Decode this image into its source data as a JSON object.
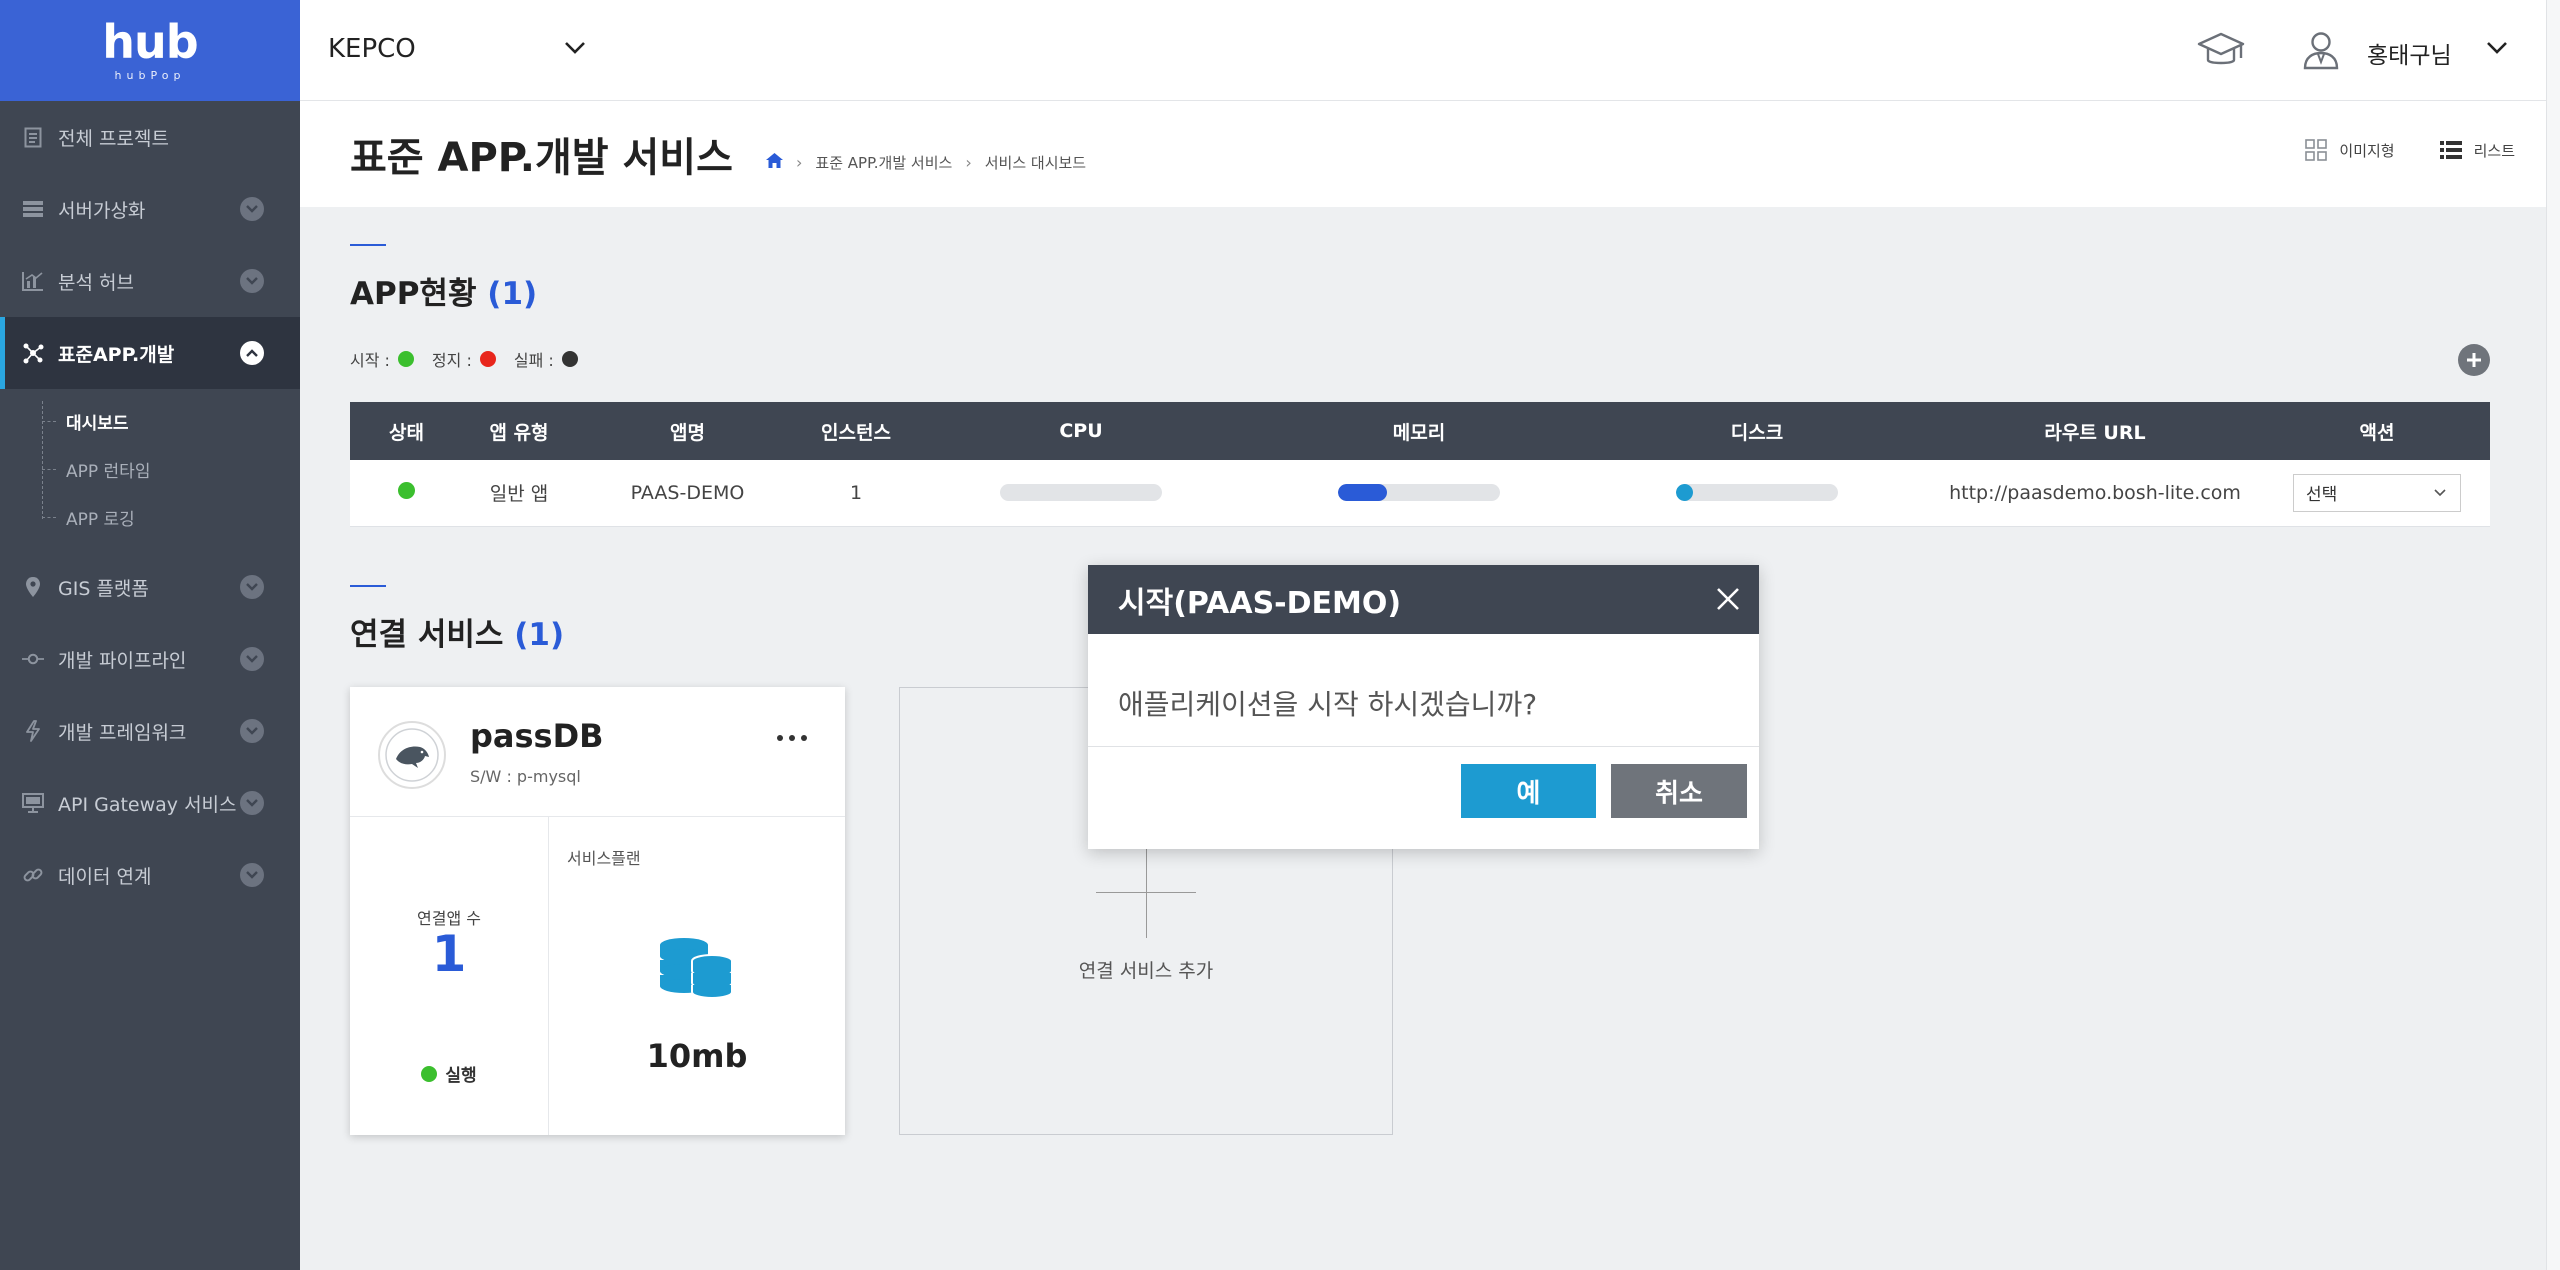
{
  "logo": {
    "mark": "hub",
    "sub": "hubPop"
  },
  "sidebar": {
    "items": [
      {
        "label": "전체 프로젝트",
        "icon": "clipboard-icon"
      },
      {
        "label": "서버가상화",
        "icon": "server-icon"
      },
      {
        "label": "분석 허브",
        "icon": "chart-icon"
      },
      {
        "label": "표준APP.개발",
        "icon": "network-icon"
      },
      {
        "label": "GIS 플랫폼",
        "icon": "map-pin-icon"
      },
      {
        "label": "개발 파이프라인",
        "icon": "pipeline-icon"
      },
      {
        "label": "개발 프레임워크",
        "icon": "bolt-icon"
      },
      {
        "label": "API Gateway 서비스",
        "icon": "monitor-icon"
      },
      {
        "label": "데이터 연계",
        "icon": "link-icon"
      }
    ],
    "subitems": [
      "대시보드",
      "APP 런타임",
      "APP 로깅"
    ]
  },
  "topbar": {
    "org": "KEPCO",
    "user": "홍태구님"
  },
  "page": {
    "title": "표준 APP.개발 서비스",
    "breadcrumb": [
      "표준 APP.개발 서비스",
      "서비스 대시보드"
    ],
    "view_image": "이미지형",
    "view_list": "리스트"
  },
  "apps": {
    "title": "APP현황",
    "count": "(1)",
    "legend": {
      "start": "시작 :",
      "stop": "정지 :",
      "fail": "실패 :"
    },
    "colors": {
      "start": "#3bbf2e",
      "stop": "#e8261c",
      "fail": "#333333"
    },
    "headers": [
      "상태",
      "앱 유형",
      "앱명",
      "인스턴스",
      "CPU",
      "메모리",
      "디스크",
      "라우트 URL",
      "액션"
    ],
    "rows": [
      {
        "status": "start",
        "type": "일반 앱",
        "name": "PAAS-DEMO",
        "instances": "1",
        "cpu": 0.0,
        "memory": 0.3,
        "disk": 0.08,
        "route": "http://paasdemo.bosh-lite.com",
        "action": "선택"
      }
    ]
  },
  "services": {
    "title": "연결 서비스",
    "count": "(1)",
    "card": {
      "name": "passDB",
      "sw": "S/W : p-mysql",
      "conn_label": "연결앱 수",
      "conn_count": "1",
      "status": "실행",
      "plan_label": "서비스플랜",
      "plan_size": "10mb"
    },
    "add_label": "연결 서비스 추가"
  },
  "modal": {
    "title": "시작(PAAS-DEMO)",
    "message": "애플리케이션을 시작 하시겠습니까?",
    "yes": "예",
    "no": "취소"
  }
}
